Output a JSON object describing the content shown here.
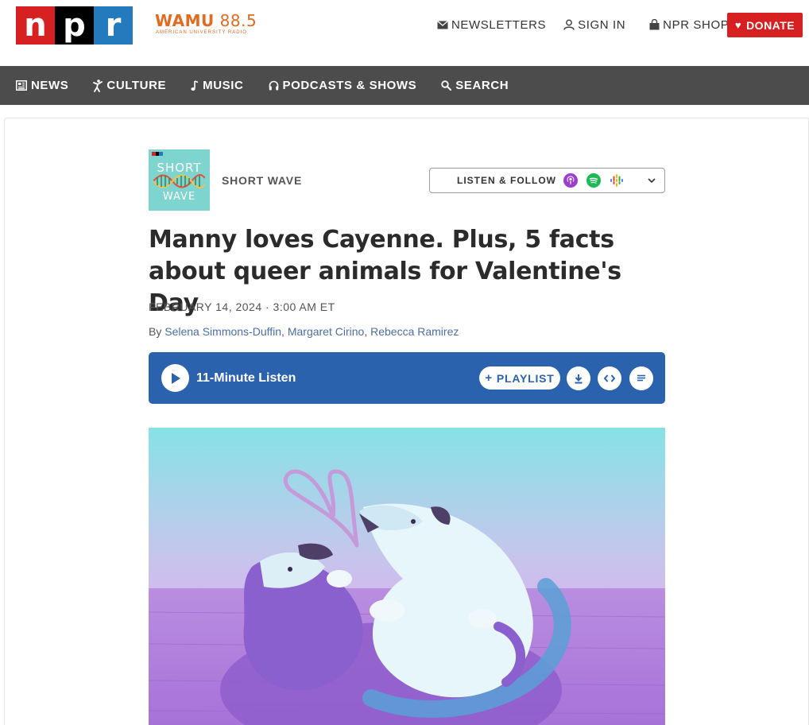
{
  "header": {
    "logo": {
      "letters": [
        "n",
        "p",
        "r"
      ],
      "colors": [
        "#d62021",
        "#000000",
        "#237bbd"
      ]
    },
    "station": {
      "name_bold": "WAMU",
      "name_freq": "88.5",
      "subtitle": "AMERICAN UNIVERSITY RADIO",
      "color": "#e36a21"
    },
    "utility_links": [
      {
        "label": "NEWSLETTERS",
        "icon": "envelope-icon"
      },
      {
        "label": "SIGN IN",
        "icon": "user-icon"
      },
      {
        "label": "NPR SHOP",
        "icon": "shopping-bag-icon"
      }
    ],
    "donate": {
      "label": "DONATE",
      "icon": "heart-icon",
      "color": "#d62021"
    }
  },
  "nav": {
    "background": "#4c4c4c",
    "items": [
      {
        "label": "NEWS",
        "icon": "newspaper-icon"
      },
      {
        "label": "CULTURE",
        "icon": "dancer-icon"
      },
      {
        "label": "MUSIC",
        "icon": "music-note-icon"
      },
      {
        "label": "PODCASTS & SHOWS",
        "icon": "headphones-icon"
      },
      {
        "label": "SEARCH",
        "icon": "search-icon"
      }
    ]
  },
  "article": {
    "show": {
      "name": "SHORT WAVE",
      "art_top": "SHORT",
      "art_bottom": "WAVE"
    },
    "listen_follow": {
      "label": "LISTEN & FOLLOW",
      "icons": [
        "apple-podcasts-icon",
        "spotify-icon",
        "google-podcasts-icon"
      ]
    },
    "headline": "Manny loves Cayenne. Plus, 5 facts about queer animals for Valentine's Day",
    "dateline": "FEBRUARY 14, 2024 · 3:00 AM ET",
    "byline": {
      "prefix": "By",
      "authors": [
        "Selena Simmons-Duffin",
        "Margaret Cirino",
        "Rebecca Ramirez"
      ]
    },
    "player": {
      "duration_label": "11-Minute Listen",
      "playlist_label": "PLAYLIST",
      "accent": "#2a62ae"
    }
  }
}
